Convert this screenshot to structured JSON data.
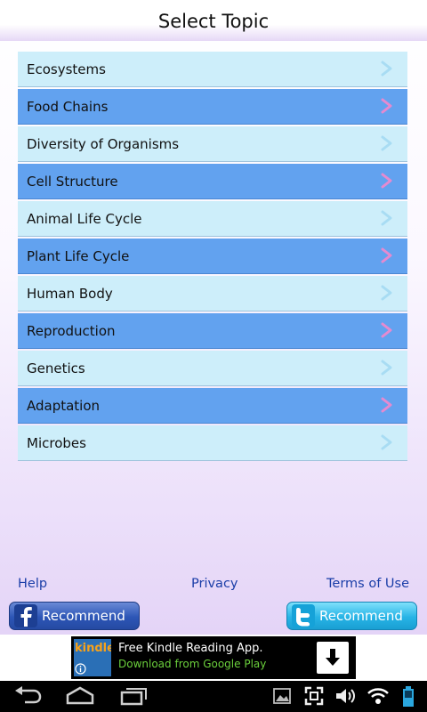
{
  "header": {
    "title": "Select Topic"
  },
  "topics": [
    {
      "label": "Ecosystems",
      "style": "light"
    },
    {
      "label": "Food Chains",
      "style": "dark"
    },
    {
      "label": "Diversity of Organisms",
      "style": "light"
    },
    {
      "label": "Cell Structure",
      "style": "dark"
    },
    {
      "label": "Animal Life Cycle",
      "style": "light"
    },
    {
      "label": "Plant Life Cycle",
      "style": "dark"
    },
    {
      "label": "Human Body",
      "style": "light"
    },
    {
      "label": "Reproduction",
      "style": "dark"
    },
    {
      "label": "Genetics",
      "style": "light"
    },
    {
      "label": "Adaptation",
      "style": "dark"
    },
    {
      "label": "Microbes",
      "style": "light"
    }
  ],
  "footer_links": {
    "help": "Help",
    "privacy": "Privacy",
    "terms": "Terms of Use"
  },
  "share": {
    "facebook": {
      "label": "Recommend",
      "icon": "facebook-icon"
    },
    "twitter": {
      "label": "Recommend",
      "icon": "twitter-icon"
    }
  },
  "ad": {
    "logo_text": "kindle",
    "title": "Free Kindle Reading App.",
    "subtitle": "Download from Google Play",
    "download_icon": "download-arrow-icon"
  },
  "colors": {
    "row_light": "#cdeefa",
    "row_dark": "#62a2ef",
    "chevron_light": "#a8dcf3",
    "chevron_dark": "#e58ad0",
    "link": "#1b3ea8"
  },
  "navbar": {
    "icons": [
      "back-icon",
      "home-icon",
      "recent-apps-icon",
      "screenshot-icon",
      "fullscreen-icon",
      "volume-icon",
      "wifi-icon",
      "battery-icon"
    ]
  }
}
